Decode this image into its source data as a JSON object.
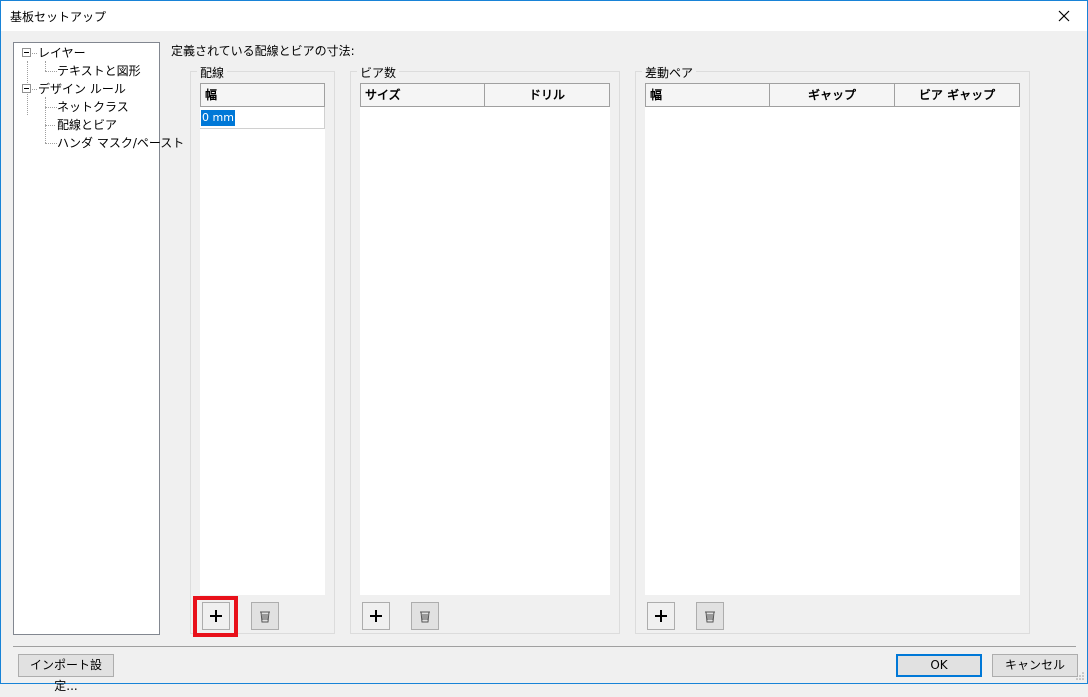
{
  "window": {
    "title": "基板セットアップ"
  },
  "tree": {
    "items": [
      {
        "label": "レイヤー"
      },
      {
        "label": "テキストと図形"
      },
      {
        "label": "デザイン ルール"
      },
      {
        "label": "ネットクラス"
      },
      {
        "label": "配線とビア"
      },
      {
        "label": "ハンダ マスク/ペースト"
      }
    ]
  },
  "main": {
    "defined_label": "定義されている配線とビアの寸法:",
    "tracks": {
      "legend": "配線",
      "columns": [
        "幅"
      ],
      "rows": [
        {
          "width": "0 mm"
        }
      ]
    },
    "vias": {
      "legend": "ビア数",
      "columns": [
        "サイズ",
        "ドリル"
      ]
    },
    "diff_pairs": {
      "legend": "差動ペア",
      "columns": [
        "幅",
        "ギャップ",
        "ビア ギャップ"
      ]
    }
  },
  "footer": {
    "import_label": "インポート設定...",
    "ok_label": "OK",
    "cancel_label": "キャンセル"
  },
  "colors": {
    "accent": "#0078d7",
    "highlight": "#e8101a",
    "window_border": "#1883d7"
  }
}
